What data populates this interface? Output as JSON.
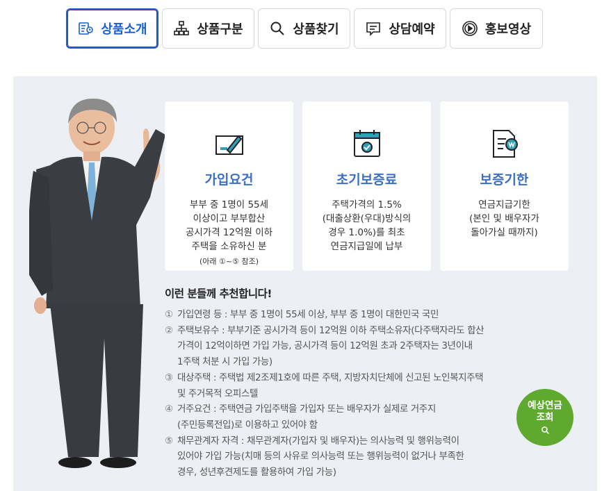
{
  "tabs": [
    {
      "label": "상품소개",
      "icon": "product-intro-icon",
      "active": true
    },
    {
      "label": "상품구분",
      "icon": "sitemap-icon",
      "active": false
    },
    {
      "label": "상품찾기",
      "icon": "search-icon",
      "active": false
    },
    {
      "label": "상담예약",
      "icon": "chat-icon",
      "active": false
    },
    {
      "label": "홍보영상",
      "icon": "play-icon",
      "active": false
    }
  ],
  "cards": [
    {
      "title": "가입요건",
      "icon": "signature-icon",
      "body": [
        "부부 중 1명이 55세",
        "이상이고 부부합산",
        "공시가격 12억원 이하",
        "주택을 소유하신 분"
      ],
      "note": "(아래 ①~⑤ 참조)"
    },
    {
      "title": "초기보증료",
      "icon": "calendar-check-icon",
      "body": [
        "주택가격의 1.5%",
        "(대출상환(우대)방식의",
        "경우 1.0%)를 최초",
        "연금지급일에 납부"
      ],
      "note": ""
    },
    {
      "title": "보증기한",
      "icon": "document-won-icon",
      "body": [
        "연금지급기한",
        "(본인 및 배우자가",
        "돌아가실 때까지)"
      ],
      "note": ""
    }
  ],
  "recommend": {
    "title": "이런 분들께 추천합니다!",
    "items": [
      {
        "num": "①",
        "lines": [
          "가입연령 등 : 부부 중 1명이 55세 이상, 부부 중 1명이 대한민국 국민"
        ]
      },
      {
        "num": "②",
        "lines": [
          "주택보유수 : 부부기준 공시가격 등이 12억원 이하 주택소유자(다주택자라도 합산",
          "가격이 12억이하면 가입 가능, 공시가격 등이 12억원 초과 2주택자는 3년이내",
          "1주택 처분 시 가입 가능)"
        ]
      },
      {
        "num": "③",
        "lines": [
          "대상주택 : 주택법 제2조제1호에 따른 주택, 지방자치단체에 신고된 노인복지주택",
          "및 주거목적 오피스텔"
        ]
      },
      {
        "num": "④",
        "lines": [
          "거주요건 : 주택연금 가입주택을 가입자 또는 배우자가 실제로 거주지",
          "(주민등록전입)로 이용하고 있어야 함"
        ]
      },
      {
        "num": "⑤",
        "lines": [
          "채무관계자 자격 : 채무관계자(가입자 및 배우자)는 의사능력 및 행위능력이",
          "있어야 가입 가능(치매 등의 사유로 의사능력 또는 행위능력이 없거나 부족한",
          "경우, 성년후견제도를 활용하여 가입 가능)"
        ]
      }
    ]
  },
  "calc_button": {
    "line1": "예상연금",
    "line2": "조회",
    "icon": "search-icon"
  },
  "colors": {
    "accent": "#3b6fc6",
    "active_tab": "#1a5fd0",
    "panel_bg": "#eceff4",
    "button_green": "#5ea92e"
  }
}
